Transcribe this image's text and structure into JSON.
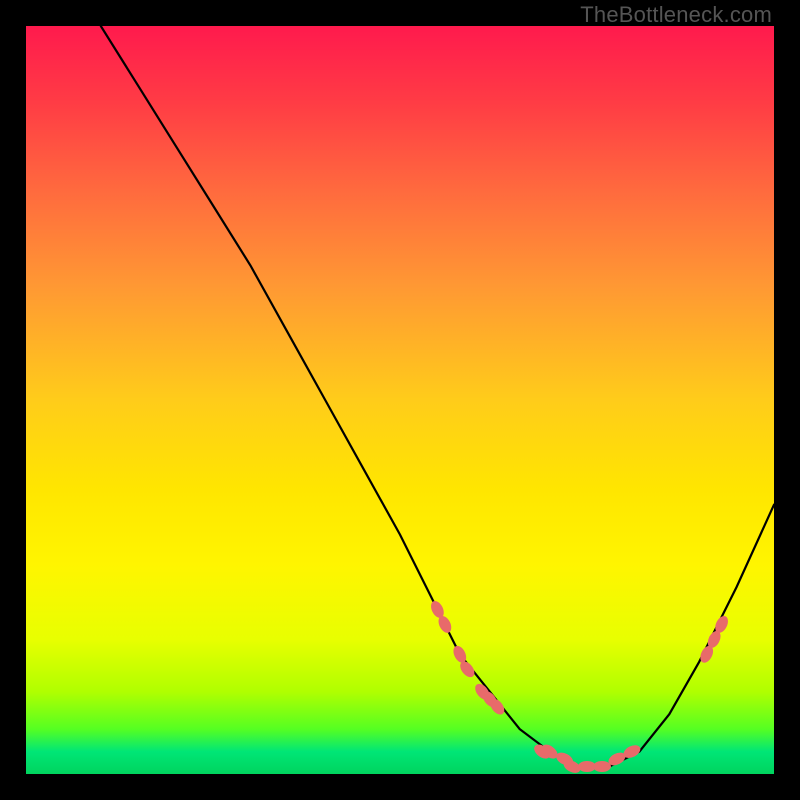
{
  "attribution": "TheBottleneck.com",
  "chart_data": {
    "type": "line",
    "title": "",
    "xlabel": "",
    "ylabel": "",
    "xlim": [
      0,
      100
    ],
    "ylim": [
      0,
      100
    ],
    "series": [
      {
        "name": "bottleneck-curve",
        "x": [
          10,
          15,
          20,
          25,
          30,
          35,
          40,
          45,
          50,
          55,
          58,
          62,
          66,
          70,
          74,
          78,
          82,
          86,
          90,
          95,
          100
        ],
        "y": [
          100,
          92,
          84,
          76,
          68,
          59,
          50,
          41,
          32,
          22,
          16,
          11,
          6,
          3,
          1,
          1,
          3,
          8,
          15,
          25,
          36
        ]
      }
    ],
    "highlight_points": {
      "name": "marked-data-points",
      "color": "#e86a6a",
      "points": [
        {
          "x": 55,
          "y": 22
        },
        {
          "x": 56,
          "y": 20
        },
        {
          "x": 58,
          "y": 16
        },
        {
          "x": 59,
          "y": 14
        },
        {
          "x": 61,
          "y": 11
        },
        {
          "x": 62,
          "y": 10
        },
        {
          "x": 63,
          "y": 9
        },
        {
          "x": 69,
          "y": 3
        },
        {
          "x": 70,
          "y": 3
        },
        {
          "x": 72,
          "y": 2
        },
        {
          "x": 73,
          "y": 1
        },
        {
          "x": 75,
          "y": 1
        },
        {
          "x": 77,
          "y": 1
        },
        {
          "x": 79,
          "y": 2
        },
        {
          "x": 81,
          "y": 3
        },
        {
          "x": 91,
          "y": 16
        },
        {
          "x": 92,
          "y": 18
        },
        {
          "x": 93,
          "y": 20
        }
      ]
    },
    "gradient_stops": [
      {
        "pos": 0,
        "color": "#ff1a4d"
      },
      {
        "pos": 50,
        "color": "#ffe600"
      },
      {
        "pos": 100,
        "color": "#00d45e"
      }
    ]
  }
}
